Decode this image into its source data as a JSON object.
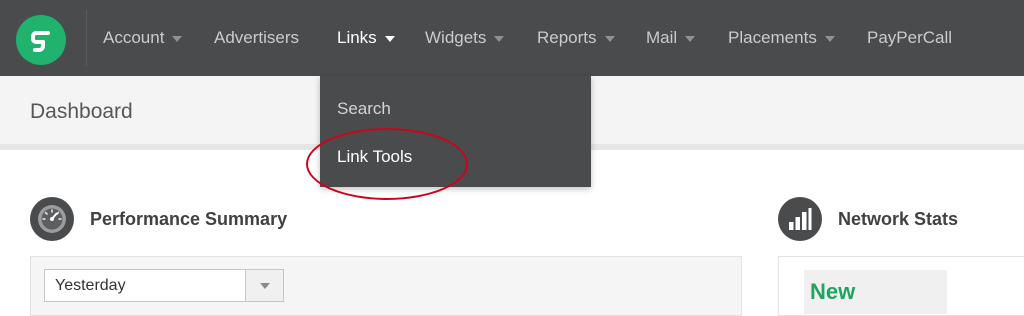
{
  "nav": {
    "items": [
      {
        "label": "Account",
        "has_caret": true
      },
      {
        "label": "Advertisers",
        "has_caret": false
      },
      {
        "label": "Links",
        "has_caret": true
      },
      {
        "label": "Widgets",
        "has_caret": true
      },
      {
        "label": "Reports",
        "has_caret": true
      },
      {
        "label": "Mail",
        "has_caret": true
      },
      {
        "label": "Placements",
        "has_caret": true
      },
      {
        "label": "PayPerCall",
        "has_caret": false
      }
    ],
    "active_item": "Links"
  },
  "links_menu": {
    "items": [
      {
        "label": "Search"
      },
      {
        "label": "Link Tools"
      }
    ],
    "annotated_item": "Link Tools"
  },
  "dashboard": {
    "title": "Dashboard"
  },
  "performance": {
    "title": "Performance Summary",
    "period_select": {
      "value": "Yesterday"
    }
  },
  "network": {
    "title": "Network Stats",
    "badge": "New"
  },
  "colors": {
    "nav_background": "#494b4c",
    "brand_green": "#1fb36d",
    "new_text_green": "#1fa55e",
    "annotation_red": "#d0021b"
  },
  "icons": {
    "logo": "cj-logo",
    "performance": "speedometer-icon",
    "network": "bar-chart-icon",
    "dropdown": "caret-down-icon"
  }
}
